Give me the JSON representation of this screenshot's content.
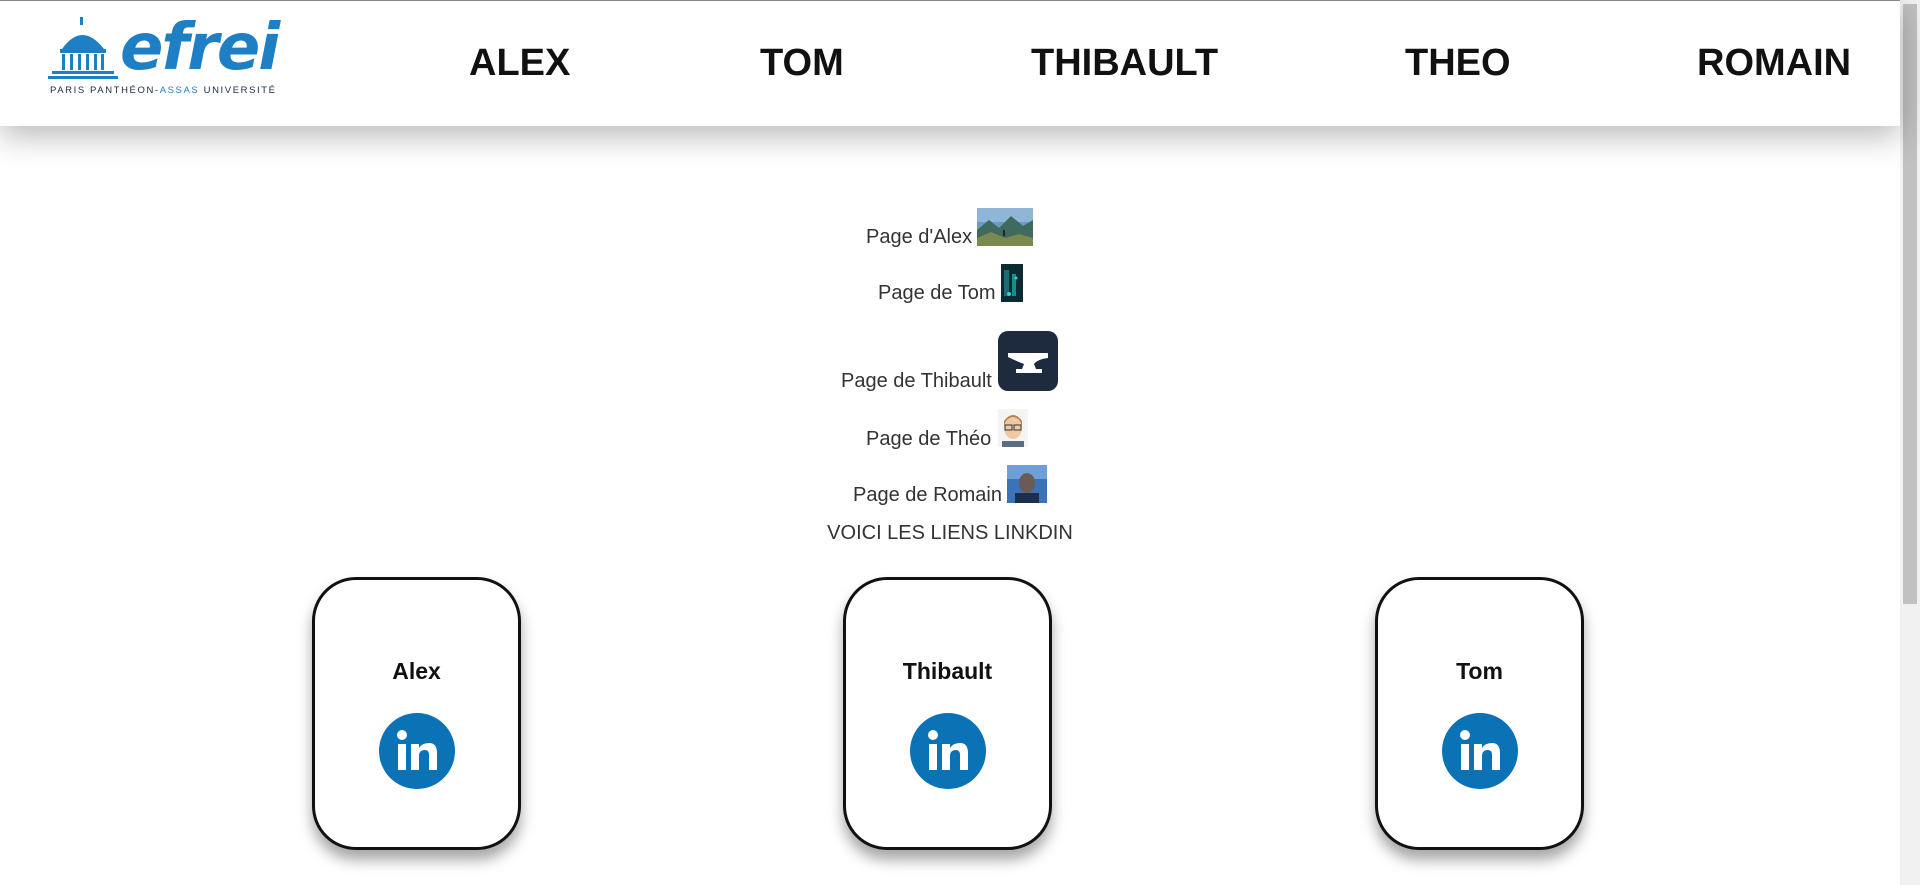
{
  "header": {
    "logo": {
      "wordmark": "efrei",
      "tagline_left": "PARIS PANTHÉON-",
      "tagline_blue": "ASSAS",
      "tagline_right": " UNIVERSITÉ"
    },
    "nav": [
      {
        "label": "ALEX"
      },
      {
        "label": "TOM"
      },
      {
        "label": "THIBAULT"
      },
      {
        "label": "THEO"
      },
      {
        "label": "ROMAIN"
      }
    ]
  },
  "pages": [
    {
      "label": "Page d'Alex",
      "thumb": "mountain-landscape-image"
    },
    {
      "label": "Page de Tom",
      "thumb": "dark-teal-image"
    },
    {
      "label": "Page de Thibault",
      "thumb": "anvil-icon"
    },
    {
      "label": "Page de Théo",
      "thumb": "portrait-photo"
    },
    {
      "label": "Page de Romain",
      "thumb": "portrait-photo-blue"
    }
  ],
  "caption": "VOICI LES LIENS LINKDIN",
  "cards": [
    {
      "name": "Alex",
      "icon": "linkedin-icon"
    },
    {
      "name": "Thibault",
      "icon": "linkedin-icon"
    },
    {
      "name": "Tom",
      "icon": "linkedin-icon"
    }
  ],
  "colors": {
    "brand_blue": "#1e7fc4",
    "linkedin_blue": "#0a72b5",
    "anvil_bg": "#1e2a3e"
  }
}
